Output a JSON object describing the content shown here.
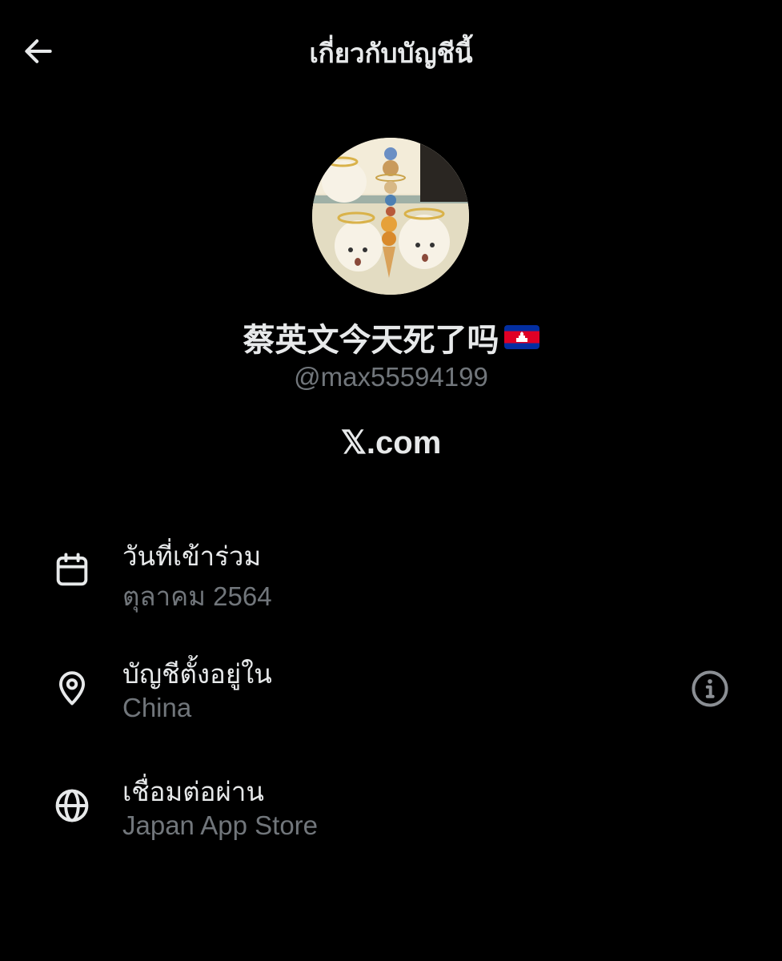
{
  "header": {
    "title": "เกี่ยวกับบัญชีนี้",
    "back_icon": "arrow-left-icon"
  },
  "profile": {
    "avatar_icon": "profile-avatar",
    "display_name": "蔡英文今天死了吗",
    "flag_icon": "cambodia-flag-icon",
    "handle": "@max55594199",
    "platform": "𝕏.com"
  },
  "details": {
    "joined": {
      "label": "วันที่เข้าร่วม",
      "value": "ตุลาคม 2564",
      "icon": "calendar-icon"
    },
    "location": {
      "label": "บัญชีตั้งอยู่ใน",
      "value": "China",
      "icon": "location-pin-icon",
      "info_icon": "info-icon"
    },
    "connected": {
      "label": "เชื่อมต่อผ่าน",
      "value": "Japan App Store",
      "icon": "globe-icon"
    }
  },
  "colors": {
    "background": "#000000",
    "primary_text": "#e7e9ea",
    "secondary_text": "#71767b"
  }
}
